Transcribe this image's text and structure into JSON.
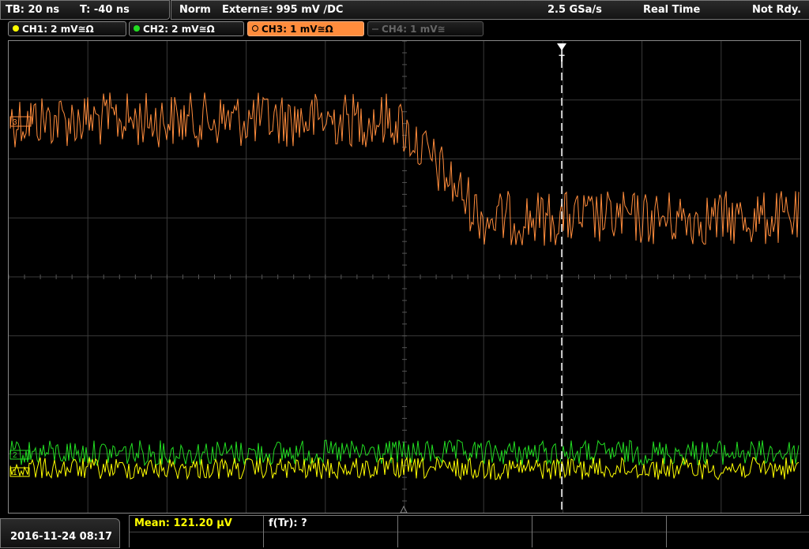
{
  "header": {
    "timebase": "TB: 20 ns",
    "trigger_offset": "T: -40 ns",
    "mode": "Norm",
    "trigger_source": "Extern≅: 995 mV ∕DC",
    "sample_rate": "2.5 GSa/s",
    "acq_mode": "Real Time",
    "state": "Not Rdy."
  },
  "channels": [
    {
      "label": "CH1: 2 mV≅Ω",
      "color": "#ffff00",
      "active": false
    },
    {
      "label": "CH2: 2 mV≅Ω",
      "color": "#22dd22",
      "active": false
    },
    {
      "label": "CH3: 1 mV≅Ω",
      "color": "#ff8c3c",
      "active": true
    },
    {
      "label": "CH4: 1 mV≅",
      "color": "#666666",
      "active": false,
      "disabled": true
    }
  ],
  "footer": {
    "datetime": "2016-11-24 08:17",
    "measurement_1": "Mean: 121.20 µV",
    "measurement_2": "f(Tr): ?"
  },
  "colors": {
    "ch1": "#ffff00",
    "ch2": "#22dd22",
    "ch3": "#ff8c3c",
    "grid": "#3a3a3a",
    "trigger_marker": "#ffffff"
  },
  "icons": [
    "trigger-marker-icon",
    "ground-marker-icon"
  ]
}
